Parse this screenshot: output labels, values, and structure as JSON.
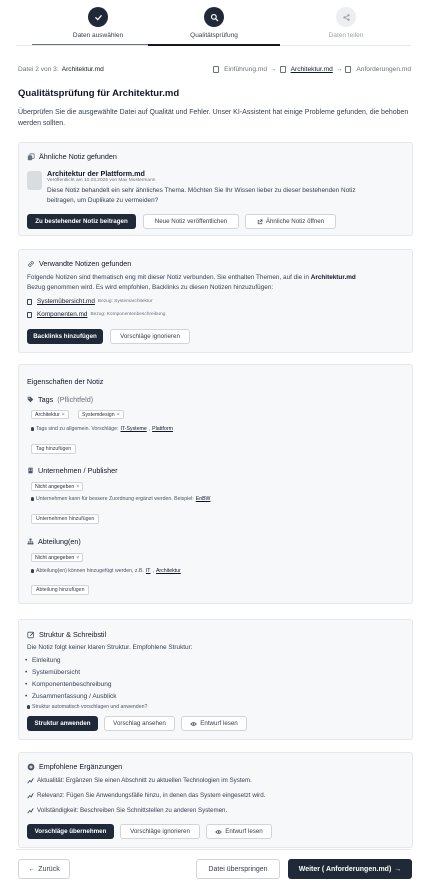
{
  "stepper": {
    "steps": [
      {
        "label": "Daten auswählen",
        "state": "done",
        "icon": "check-icon"
      },
      {
        "label": "Qualitätsprüfung",
        "state": "active",
        "icon": "search-icon"
      },
      {
        "label": "Daten teilen",
        "state": "upcoming",
        "icon": "share-icon"
      }
    ]
  },
  "filebar": {
    "progress": "Datei 2 von 3:",
    "current_file": "Architektur.md",
    "crumbs": [
      "Einführung.md",
      "Architektur.md",
      "Anforderungen.md"
    ]
  },
  "page": {
    "title": "Qualitätsprüfung für Architektur.md",
    "description": "Überprüfen Sie die ausgewählte Datei auf Qualität und Fehler. Unser KI-Assistent hat einige Probleme gefunden, die behoben werden sollten."
  },
  "similar": {
    "title": "Ähnliche Notiz gefunden",
    "note_title": "Architektur der Plattform.md",
    "note_meta": "Veröffentlicht am 10.03.2025 von Max Mustermann",
    "note_text_1": "Diese Notiz behandelt ein sehr ähnliches Thema. Möchten Sie Ihr Wissen lieber zu dieser bestehenden Notiz",
    "note_text_2": "beitragen, um Duplikate zu vermeiden?",
    "btn_contribute": "Zu bestehender Notiz beitragen",
    "btn_new": "Neue Notiz veröffentlichen",
    "btn_open": "Ähnliche Notiz öffnen"
  },
  "related": {
    "title": "Verwandte Notizen gefunden",
    "text_1a": "Folgende Notizen sind thematisch eng mit dieser Notiz verbunden. Sie enthalten Themen, auf die in ",
    "text_1b": "Architektur.md",
    "text_2": "Bezug genommen wird. Es wird empfohlen, Backlinks zu diesen Notizen hinzuzufügen:",
    "items": [
      {
        "file": "Systemübersicht.md",
        "ref": "Bezug: Systemarchitektur"
      },
      {
        "file": "Komponenten.md",
        "ref": "Bezug: Komponentenbeschreibung"
      }
    ],
    "btn_add": "Backlinks hinzufügen",
    "btn_ignore": "Vorschläge ignorieren"
  },
  "properties": {
    "title": "Eigenschaften der Notiz",
    "tags_label": "Tags",
    "tags_required": "(Pflichtfeld)",
    "tags": [
      "Architektur",
      "Systemdesign"
    ],
    "tags_hint": "Tags sind zu allgemein. Vorschläge:",
    "tags_suggestions": [
      "IT-Systeme",
      "Plattform"
    ],
    "tags_btn": "Tag hinzufügen",
    "company_label": "Unternehmen / Publisher",
    "company_value": "Nicht angegeben",
    "company_hint": "Unternehmen kann für bessere Zuordnung ergänzt werden. Beispiel:",
    "company_example": "EnBW",
    "company_btn": "Unternehmen hinzufügen",
    "dept_label": "Abteilung(en)",
    "dept_value": "Nicht angegeben",
    "dept_hint": "Abteilung(en) können hinzugefügt werden, z.B.",
    "dept_examples": [
      "IT",
      "Architektur"
    ],
    "dept_btn": "Abteilung hinzufügen"
  },
  "structure": {
    "title": "Struktur & Schreibstil",
    "intro": "Die Notiz folgt keiner klaren Struktur. Empfohlene Struktur:",
    "items": [
      "Einleitung",
      "Systemübersicht",
      "Komponentenbeschreibung",
      "Zusammenfassung / Ausblick"
    ],
    "hint": "Struktur automatisch vorschlagen und anwenden?",
    "btn_apply": "Struktur anwenden",
    "btn_preview": "Vorschlag ansehen",
    "btn_read": "Entwurf lesen"
  },
  "additions": {
    "title": "Empfohlene Ergänzungen",
    "items": [
      "Aktualität: Ergänzen Sie einen Abschnitt zu aktuellen Technologien im System.",
      "Relevanz: Fügen Sie Anwendungsfälle hinzu, in denen das System eingesetzt wird.",
      "Vollständigkeit: Beschreiben Sie Schnittstellen zu anderen Systemen."
    ],
    "btn_accept": "Vorschläge übernehmen",
    "btn_ignore": "Vorschläge ignorieren",
    "btn_read": "Entwurf lesen"
  },
  "footer": {
    "back": "Zurück",
    "skip": "Datei überspringen",
    "next": "Weiter ( Anforderungen.md)"
  },
  "colors": {
    "primary": "#1f2937",
    "card_bg": "#f7f8f9",
    "border": "#e5e7eb"
  }
}
